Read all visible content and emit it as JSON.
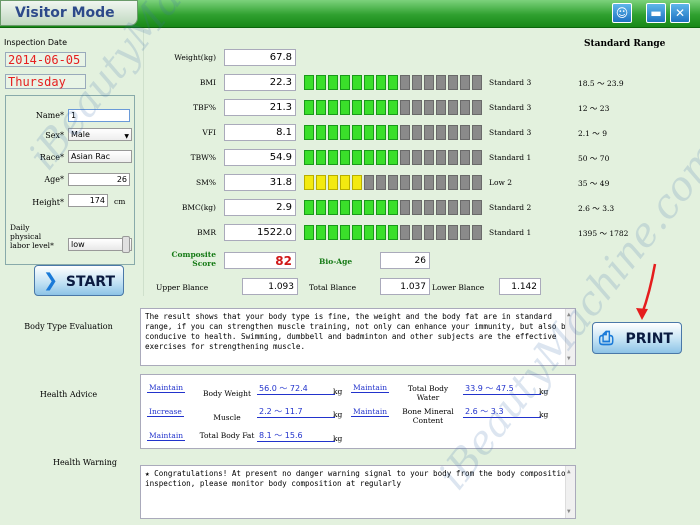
{
  "window": {
    "mode_title": "Visitor Mode",
    "icons": [
      "user-icon",
      "minimize-icon",
      "close-icon"
    ]
  },
  "left": {
    "inspection_date_label": "Inspection Date",
    "date": "2014-06-05",
    "weekday": "Thursday",
    "fields": [
      {
        "label": "Name*",
        "value": "1"
      },
      {
        "label": "Sex*",
        "value": "Male"
      },
      {
        "label": "Race*",
        "value": "Asian Rac"
      },
      {
        "label": "Age*",
        "value": "26"
      },
      {
        "label": "Height*",
        "value": "174",
        "unit": "cm"
      },
      {
        "label": "Daily physical labor level*",
        "value": "low"
      }
    ],
    "start_label": "START"
  },
  "metrics": {
    "standard_range_title": "Standard Range",
    "weight": {
      "label": "Weight(kg)",
      "value": "67.8"
    },
    "rows": [
      {
        "label": "BMI",
        "value": "22.3",
        "bars": "ggggggggddddddddd",
        "status": "Standard 3",
        "range": "18.5 ～ 23.9"
      },
      {
        "label": "TBF%",
        "value": "21.3",
        "bars": "ggggggggddddddddd",
        "status": "Standard 3",
        "range": "12 ～ 23"
      },
      {
        "label": "VFI",
        "value": "8.1",
        "bars": "ggggggggddddddddd",
        "status": "Standard 3",
        "range": "2.1 ～ 9"
      },
      {
        "label": "TBW%",
        "value": "54.9",
        "bars": "ggggggggddddddddd",
        "status": "Standard 1",
        "range": "50 ～ 70"
      },
      {
        "label": "SM%",
        "value": "31.8",
        "bars": "yyyyyddddddddddddd",
        "status": "Low 2",
        "range": "35 ～ 49"
      },
      {
        "label": "BMC(kg)",
        "value": "2.9",
        "bars": "ggggggggddddddddd",
        "status": "Standard 2",
        "range": "2.6 ～ 3.3"
      },
      {
        "label": "BMR",
        "value": "1522.0",
        "bars": "ggggggggddddddddd",
        "status": "Standard 1",
        "range": "1395 ～ 1782"
      }
    ],
    "composite_label": "Composite Score",
    "composite_value": "82",
    "bio_age_label": "Bio-Age",
    "bio_age_value": "26",
    "upper_label": "Upper Blance",
    "upper_value": "1.093",
    "total_label": "Total Blance",
    "total_value": "1.037",
    "lower_label": "Lower Blance",
    "lower_value": "1.142"
  },
  "evaluation": {
    "label": "Body Type Evaluation",
    "text": "The result shows that your body type is fine, the weight and the body fat are in standard range, if you can strengthen muscle training, not only can enhance your immunity, but also be conducive to health. Swimming, dumbbell and badminton and other subjects are the effective exercises for strengthening muscle."
  },
  "print_label": "PRINT",
  "advice": {
    "label": "Health Advice",
    "items": [
      {
        "action": "Maintain",
        "name": "Body Weight",
        "range": "56.0 ～ 72.4",
        "unit": "kg"
      },
      {
        "action": "Increase",
        "name": "Muscle",
        "range": "2.2 ～ 11.7",
        "unit": "kg"
      },
      {
        "action": "Maintain",
        "name": "Total Body Fat",
        "range": "8.1 ～ 15.6",
        "unit": "kg"
      },
      {
        "action": "Maintain",
        "name": "Total Body Water",
        "range": "33.9 ～ 47.5",
        "unit": "kg"
      },
      {
        "action": "Maintain",
        "name": "Bone Mineral Content",
        "range": "2.6 ～ 3.3",
        "unit": "kg"
      }
    ]
  },
  "warning": {
    "label": "Health Warning",
    "text": "★ Congratulations! At present no danger warning signal to your body from the body composition inspection, please monitor body composition at regularly"
  },
  "watermark": "iBeautyMachine.com"
}
